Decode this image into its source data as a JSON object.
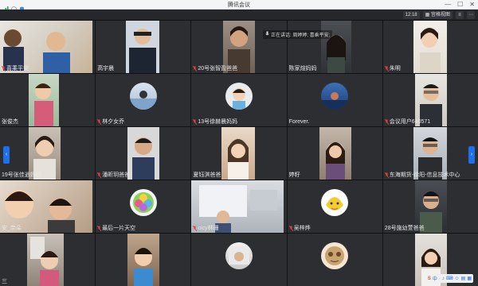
{
  "window": {
    "title": "腾讯会议",
    "minimize": "—",
    "maximize": "☐",
    "close": "✕"
  },
  "toolbar": {
    "time": "12:18",
    "view_label": "宫格视图",
    "menu_icon": "≡",
    "more_icon": "⋯"
  },
  "speaking": "正在讲话: 周婷婷; 喜乘平安;",
  "nav": {
    "left": "‹",
    "right": "›"
  },
  "tiles": [
    {
      "name": "喜乘平安",
      "muted": true
    },
    {
      "name": "高宇晨",
      "muted": false
    },
    {
      "name": "20号张智盈爸爸",
      "muted": true
    },
    {
      "name": "陈家煊妈妈",
      "muted": false
    },
    {
      "name": "朱明",
      "muted": true
    },
    {
      "name": "张俊杰",
      "muted": false
    },
    {
      "name": "林夕女乔",
      "muted": true
    },
    {
      "name": "13号徐赫晨妈妈",
      "muted": true
    },
    {
      "name": "Forever.",
      "muted": false
    },
    {
      "name": "会议用户640571",
      "muted": true
    },
    {
      "name": "19号张佳逍妈妈",
      "muted": false
    },
    {
      "name": "潘昕玥爸爸",
      "muted": true
    },
    {
      "name": "夏钰淇爸爸",
      "muted": false
    },
    {
      "name": "婷籽",
      "muted": false
    },
    {
      "name": "东海期货-徐阳-信息技术中心",
      "muted": true
    },
    {
      "name": "安_奈朵",
      "muted": false
    },
    {
      "name": "最后一片天空",
      "muted": true
    },
    {
      "name": "cicy林珊",
      "muted": true
    },
    {
      "name": "吴梓烨",
      "muted": true
    },
    {
      "name": "28号施幼萱爸爸",
      "muted": false
    },
    {
      "name": "三",
      "muted": false
    },
    {
      "name": "",
      "muted": false
    },
    {
      "name": "",
      "muted": false
    },
    {
      "name": "",
      "muted": false
    },
    {
      "name": "",
      "muted": false
    }
  ],
  "ime": [
    "S",
    "中",
    "·",
    "♪",
    "⌨",
    "☺",
    "▤",
    "▦"
  ]
}
